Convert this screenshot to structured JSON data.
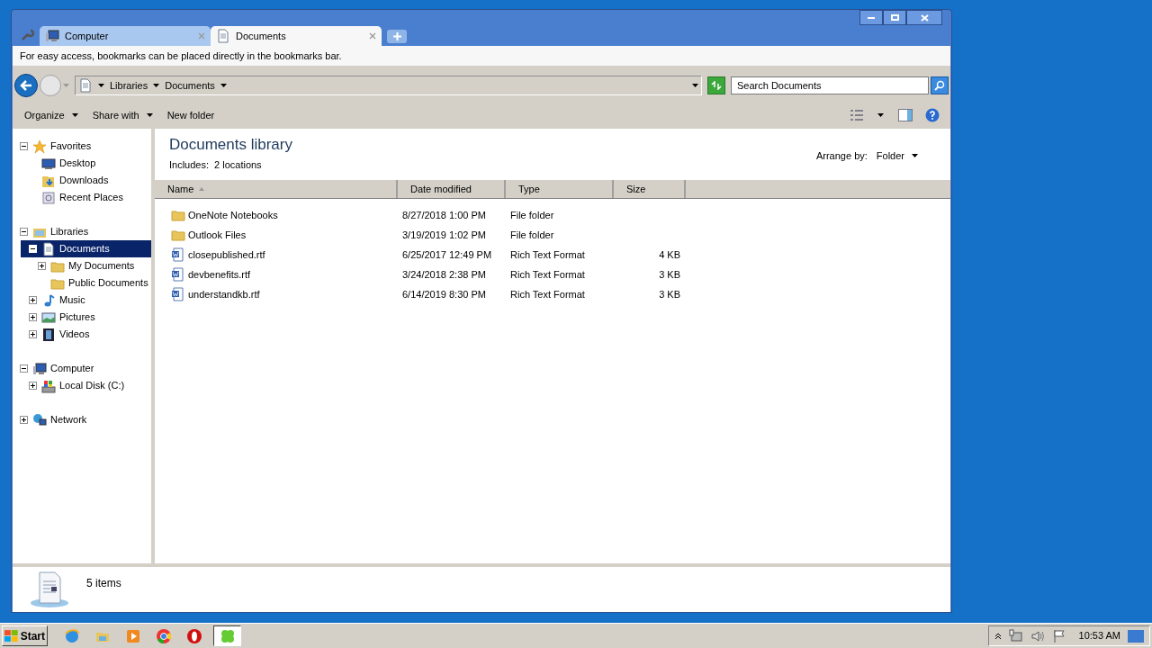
{
  "tabs": [
    {
      "label": "Computer",
      "kind": "computer",
      "selected": false
    },
    {
      "label": "Documents",
      "kind": "document",
      "selected": true
    }
  ],
  "bookmark_hint": "For easy access, bookmarks can be placed directly in the bookmarks bar.",
  "address": {
    "crumbs": [
      "Libraries",
      "Documents"
    ],
    "search_placeholder": "Search Documents"
  },
  "toolbar": [
    {
      "label": "Organize",
      "dropdown": true
    },
    {
      "label": "Share with",
      "dropdown": true
    },
    {
      "label": "New folder",
      "dropdown": false
    }
  ],
  "nav": [
    {
      "label": "Favorites",
      "kind": "star",
      "expanded": true,
      "selected": false,
      "children": [
        {
          "label": "Desktop",
          "kind": "desktop",
          "selected": false
        },
        {
          "label": "Downloads",
          "kind": "downloads",
          "selected": false
        },
        {
          "label": "Recent Places",
          "kind": "recent",
          "selected": false
        }
      ]
    },
    {
      "label": "Libraries",
      "kind": "libraries",
      "expanded": true,
      "selected": false,
      "children": [
        {
          "label": "Documents",
          "kind": "document",
          "expanded": true,
          "selected": true,
          "children": [
            {
              "label": "My Documents",
              "kind": "folder",
              "expanded": false,
              "selected": false
            },
            {
              "label": "Public Documents",
              "kind": "folder",
              "selected": false
            }
          ]
        },
        {
          "label": "Music",
          "kind": "music",
          "expanded": false,
          "selected": false
        },
        {
          "label": "Pictures",
          "kind": "pictures",
          "expanded": false,
          "selected": false
        },
        {
          "label": "Videos",
          "kind": "videos",
          "expanded": false,
          "selected": false
        }
      ]
    },
    {
      "label": "Computer",
      "kind": "computer",
      "expanded": true,
      "selected": false,
      "children": [
        {
          "label": "Local Disk (C:)",
          "kind": "disk",
          "expanded": false,
          "selected": false
        }
      ]
    },
    {
      "label": "Network",
      "kind": "network",
      "expanded": false,
      "selected": false
    }
  ],
  "library": {
    "title": "Documents library",
    "includes_label": "Includes:",
    "includes_value": "2 locations",
    "arrange_label": "Arrange by:",
    "arrange_value": "Folder"
  },
  "columns": [
    {
      "label": "Name",
      "sorted": true
    },
    {
      "label": "Date modified",
      "sorted": false
    },
    {
      "label": "Type",
      "sorted": false
    },
    {
      "label": "Size",
      "sorted": false
    }
  ],
  "rows": [
    {
      "kind": "folder",
      "name": "OneNote Notebooks",
      "date": "8/27/2018 1:00 PM",
      "type": "File folder"
    },
    {
      "kind": "folder",
      "name": "Outlook Files",
      "date": "3/19/2019 1:02 PM",
      "type": "File folder"
    },
    {
      "kind": "rtf",
      "name": "closepublished.rtf",
      "date": "6/25/2017 12:49 PM",
      "type": "Rich Text Format",
      "size": "4 KB"
    },
    {
      "kind": "rtf",
      "name": "devbenefits.rtf",
      "date": "3/24/2018 2:38 PM",
      "type": "Rich Text Format",
      "size": "3 KB"
    },
    {
      "kind": "rtf",
      "name": "understandkb.rtf",
      "date": "6/14/2019 8:30 PM",
      "type": "Rich Text Format",
      "size": "3 KB"
    }
  ],
  "status": "5 items",
  "taskbar": {
    "start": "Start",
    "apps": [
      {
        "kind": "ie",
        "selected": false
      },
      {
        "kind": "explorer",
        "selected": false
      },
      {
        "kind": "media",
        "selected": false
      },
      {
        "kind": "chrome",
        "selected": false
      },
      {
        "kind": "opera",
        "selected": false
      },
      {
        "kind": "clover",
        "selected": true
      }
    ],
    "time": "10:53 AM"
  }
}
